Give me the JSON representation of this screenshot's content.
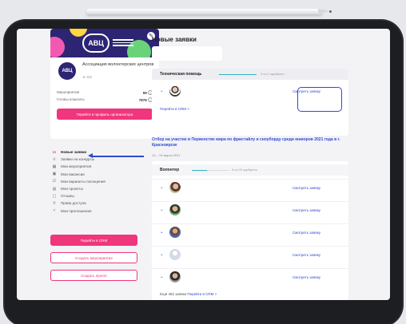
{
  "organizer": {
    "name": "Ассоциация волонтерских центров",
    "rating": "4.0",
    "logo_text": "АВЦ",
    "stats": [
      {
        "label": "Мероприятия",
        "value": "59"
      },
      {
        "label": "Готовы помогать",
        "value": "7876"
      }
    ],
    "profile_button": "Перейти в профиль организатора"
  },
  "menu": {
    "items": [
      {
        "label": "Новые заявки",
        "icon": "inbox-icon",
        "active": true
      },
      {
        "label": "Заявки на конкурсы",
        "icon": "trophy-icon"
      },
      {
        "label": "Мои мероприятия",
        "icon": "calendar-icon"
      },
      {
        "label": "Мои вакансии",
        "icon": "briefcase-icon"
      },
      {
        "label": "Мои варианты посещения",
        "icon": "checklist-icon"
      },
      {
        "label": "Мои проекты",
        "icon": "folder-icon"
      },
      {
        "label": "Отзывы",
        "icon": "chat-icon"
      },
      {
        "label": "Права доступа",
        "icon": "key-icon"
      },
      {
        "label": "Мои приглашения",
        "icon": "share-icon"
      }
    ],
    "crm_button": "Перейти в CRM",
    "create_event_button": "Создать мероприятие",
    "create_project_button": "Создать проект"
  },
  "main": {
    "title": "Новые заявки",
    "tech_card": {
      "title": "Техническая помощь",
      "approved": "2 из 0 одобрено",
      "progress": 1.0,
      "view_label": "Смотреть заявку",
      "crm_link": "Перейти в CRM >"
    },
    "event": {
      "title": "Отбор на участие в Первенстве мира по фристайлу и сноуборду среди юниоров 2021 года в г. Красноярске",
      "date": "13 – 19 марта 2021"
    },
    "volunteer_card": {
      "title": "Волонтер",
      "approved": "8 из 20 одобрено",
      "progress": 0.4,
      "view_label": "Смотреть заявку",
      "rows": 5,
      "more_text": "Ещё 482 заявки",
      "crm_link": "Перейти в CRM >"
    }
  },
  "colors": {
    "accent": "#f0367c",
    "link": "#2f49d1",
    "brand": "#2d2474"
  }
}
